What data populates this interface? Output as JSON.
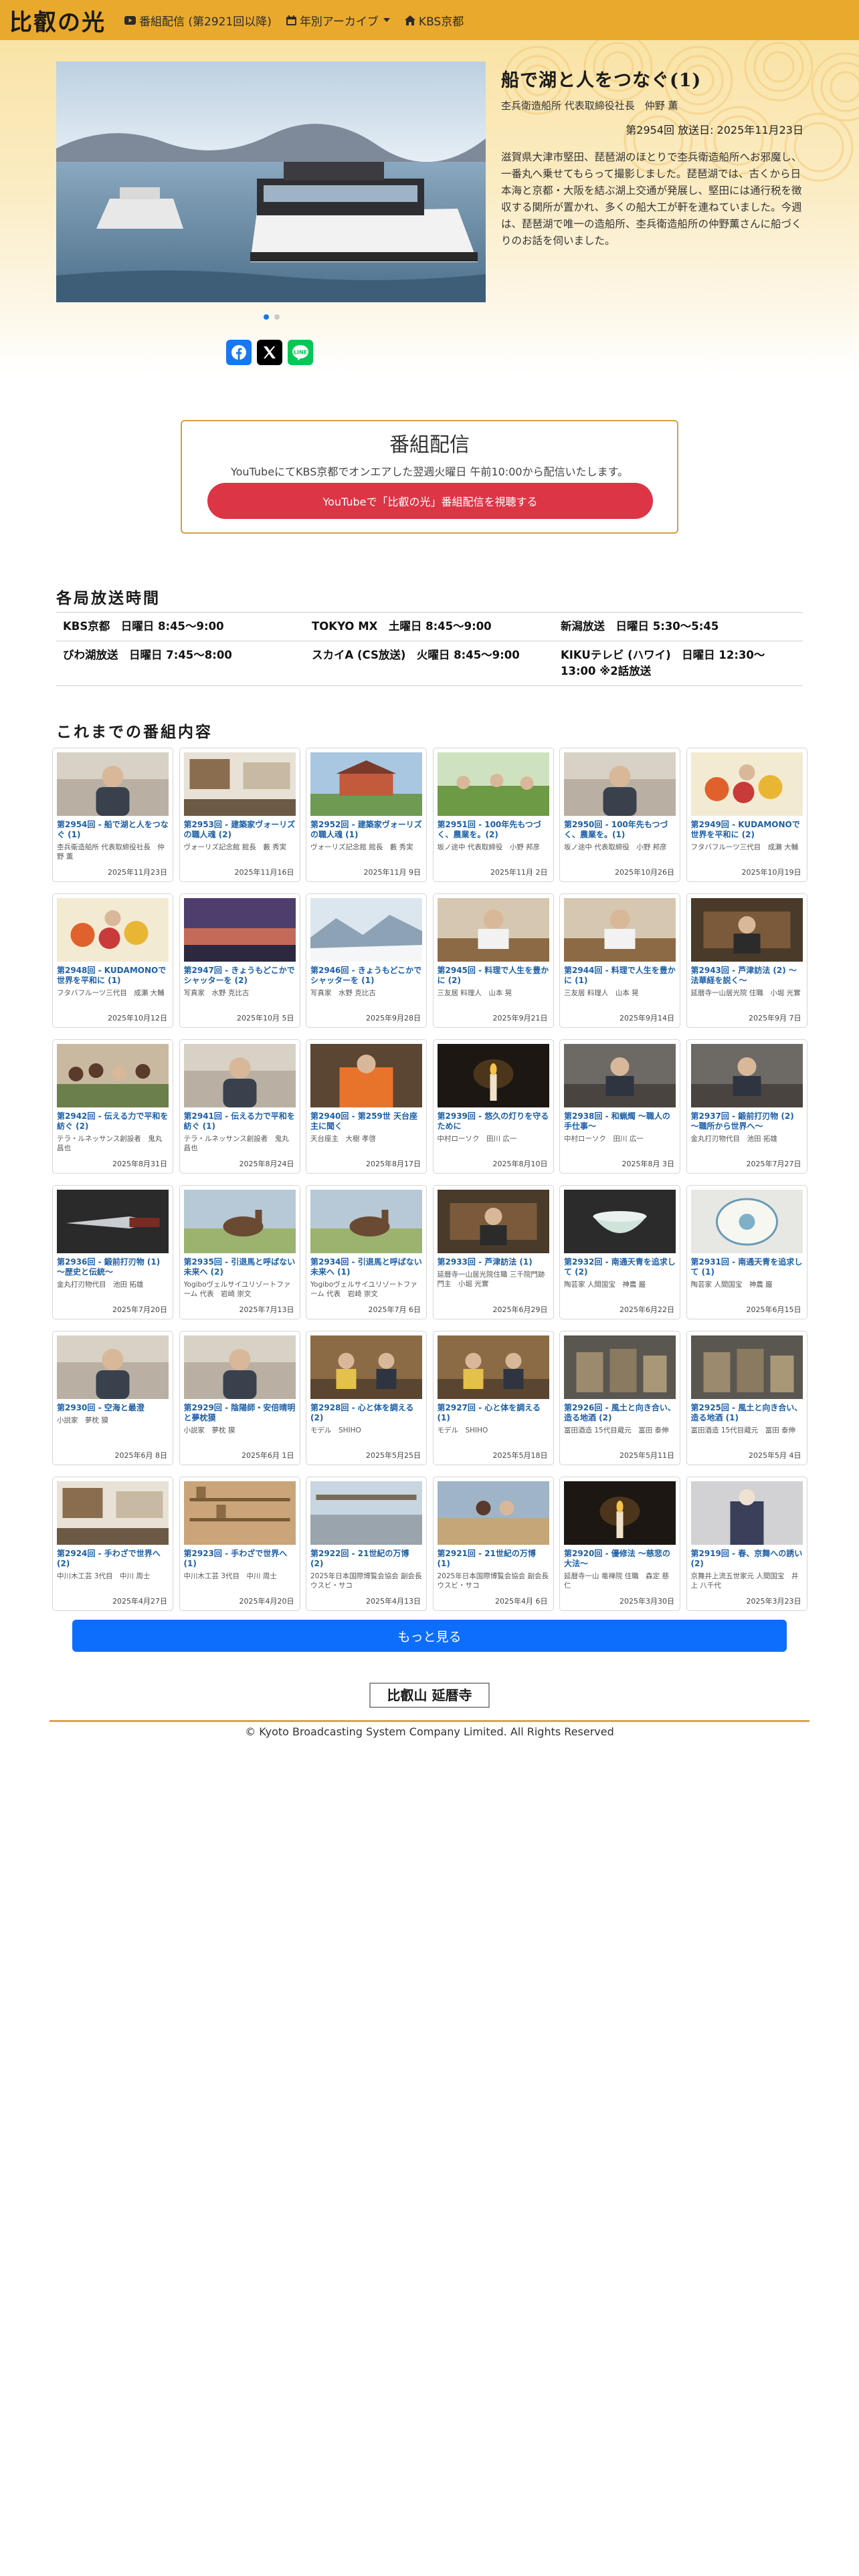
{
  "nav": {
    "brand": "比叡の光",
    "links": [
      {
        "label": "番組配信 (第2921回以降)",
        "icon": "youtube-icon"
      },
      {
        "label": "年別アーカイブ",
        "icon": "calendar-icon"
      },
      {
        "label": "KBS京都",
        "icon": "home-icon"
      }
    ],
    "color": "#e9a92c"
  },
  "hero": {
    "title": "船で湖と人をつなぐ(1)",
    "subtitle": "杢兵衛造船所 代表取締役社長　仲野 薫",
    "meta": "第2954回 放送日: 2025年11月23日",
    "description": "滋賀県大津市堅田、琵琶湖のほとりで杢兵衛造船所へお邪魔し、一番丸へ乗せてもらって撮影しました。琵琶湖では、古くから日本海と京都・大阪を結ぶ湖上交通が発展し、堅田には通行税を徴収する関所が置かれ、多くの船大工が軒を連ねていました。今週は、琵琶湖で唯一の造船所、杢兵衛造船所の仲野薫さんに船づくりのお話を伺いました。"
  },
  "broadcast": {
    "title": "番組配信",
    "text": "YouTubeにてKBS京都でオンエアした翌週火曜日 午前10:00から配信いたします。",
    "button": "YouTubeで「比叡の光」番組配信を視聴する"
  },
  "schedule": {
    "title": "各局放送時間",
    "rows": [
      [
        "KBS京都　日曜日 8:45～9:00",
        "TOKYO MX　土曜日 8:45～9:00",
        "新潟放送　日曜日 5:30～5:45"
      ],
      [
        "びわ湖放送　日曜日 7:45～8:00",
        "スカイA (CS放送)　火曜日 8:45～9:00",
        "KIKUテレビ (ハワイ)　日曜日 12:30～13:00 ※2話放送"
      ]
    ]
  },
  "episodes_title": "これまでの番組内容",
  "episodes": [
    {
      "title": "第2954回 - 船で湖と人をつなぐ (1)",
      "guest": "杢兵衛造船所 代表取締役社長　仲野 薫",
      "date": "2025年11月23日",
      "scene": "person"
    },
    {
      "title": "第2953回 - 建築家ヴォーリズの職人魂 (2)",
      "guest": "ヴォーリズ記念館 館長　藪 秀実",
      "date": "2025年11月16日",
      "scene": "room"
    },
    {
      "title": "第2952回 - 建築家ヴォーリズの職人魂 (1)",
      "guest": "ヴォーリズ記念館 館長　藪 秀実",
      "date": "2025年11月 9日",
      "scene": "building"
    },
    {
      "title": "第2951回 - 100年先もつづく、農業を。(2)",
      "guest": "坂ノ途中 代表取締役　小野 邦彦",
      "date": "2025年11月 2日",
      "scene": "field"
    },
    {
      "title": "第2950回 - 100年先もつづく、農業を。(1)",
      "guest": "坂ノ途中 代表取締役　小野 邦彦",
      "date": "2025年10月26日",
      "scene": "person"
    },
    {
      "title": "第2949回 - KUDAMONOで世界を平和に (2)",
      "guest": "フタバフルーツ三代目　成瀬 大輔",
      "date": "2025年10月19日",
      "scene": "fruit"
    },
    {
      "title": "第2948回 - KUDAMONOで世界を平和に (1)",
      "guest": "フタバフルーツ三代目　成瀬 大輔",
      "date": "2025年10月12日",
      "scene": "fruit"
    },
    {
      "title": "第2947回 - きょうもどこかでシャッターを (2)",
      "guest": "写真家　水野 克比古",
      "date": "2025年10月 5日",
      "scene": "sunset"
    },
    {
      "title": "第2946回 - きょうもどこかでシャッターを (1)",
      "guest": "写真家　水野 克比古",
      "date": "2025年9月28日",
      "scene": "snow"
    },
    {
      "title": "第2945回 - 料理で人生を豊かに (2)",
      "guest": "三友居 料理人　山本 晃",
      "date": "2025年9月21日",
      "scene": "kitchen"
    },
    {
      "title": "第2944回 - 料理で人生を豊かに (1)",
      "guest": "三友居 料理人　山本 晃",
      "date": "2025年9月14日",
      "scene": "kitchen"
    },
    {
      "title": "第2943回 - 芦津訪法 (2) ～法華経を説く～",
      "guest": "延暦寺一山居光院 住職　小堀 光實",
      "date": "2025年9月 7日",
      "scene": "temple"
    },
    {
      "title": "第2942回 - 伝える力で平和を紡ぐ (2)",
      "guest": "テラ・ルネッサンス創設者　鬼丸 昌也",
      "date": "2025年8月31日",
      "scene": "crowd"
    },
    {
      "title": "第2941回 - 伝える力で平和を紡ぐ (1)",
      "guest": "テラ・ルネッサンス創設者　鬼丸 昌也",
      "date": "2025年8月24日",
      "scene": "person"
    },
    {
      "title": "第2940回 - 第259世 天台座主に聞く",
      "guest": "天台座主　大樹 孝啓",
      "date": "2025年8月17日",
      "scene": "monk"
    },
    {
      "title": "第2939回 - 悠久の灯りを守るために",
      "guest": "中村ローソク　田川 広一",
      "date": "2025年8月10日",
      "scene": "candle"
    },
    {
      "title": "第2938回 - 和蝋燭 ～職人の手仕事～",
      "guest": "中村ローソク　田川 広一",
      "date": "2025年8月 3日",
      "scene": "workshop"
    },
    {
      "title": "第2937回 - 鍛前打刃物 (2) ～職所から世界へ～",
      "guest": "金丸打刃物代目　池田 拓雄",
      "date": "2025年7月27日",
      "scene": "workshop"
    },
    {
      "title": "第2936回 - 鍛前打刃物 (1) ～歴史と伝統～",
      "guest": "金丸打刃物代目　池田 拓雄",
      "date": "2025年7月20日",
      "scene": "knife"
    },
    {
      "title": "第2935回 - 引退馬と呼ばない未来へ (2)",
      "guest": "Yogiboヴェルサイユリゾートファーム 代表　岩崎 崇文",
      "date": "2025年7月13日",
      "scene": "horse"
    },
    {
      "title": "第2934回 - 引退馬と呼ばない未来へ (1)",
      "guest": "Yogiboヴェルサイユリゾートファーム 代表　岩崎 崇文",
      "date": "2025年7月 6日",
      "scene": "horse"
    },
    {
      "title": "第2933回 - 芦津訪法 (1)",
      "guest": "延暦寺一山居光院住職 三千院門跡門主　小堀 光實",
      "date": "2025年6月29日",
      "scene": "temple"
    },
    {
      "title": "第2932回 - 南通天青を追求して (2)",
      "guest": "陶芸家 人間国宝　神農 巌",
      "date": "2025年6月22日",
      "scene": "bowl"
    },
    {
      "title": "第2931回 - 南通天青を追求して (1)",
      "guest": "陶芸家 人間国宝　神農 巌",
      "date": "2025年6月15日",
      "scene": "plate"
    },
    {
      "title": "第2930回 - 空海と最澄",
      "guest": "小説家　夢枕 獏",
      "date": "2025年6月 8日",
      "scene": "person"
    },
    {
      "title": "第2929回 - 陰陽師・安倍晴明と夢枕獏",
      "guest": "小説家　夢枕 獏",
      "date": "2025年6月 1日",
      "scene": "person"
    },
    {
      "title": "第2928回 - 心と体を調える (2)",
      "guest": "モデル　SHIHO",
      "date": "2025年5月25日",
      "scene": "talk"
    },
    {
      "title": "第2927回 - 心と体を調える (1)",
      "guest": "モデル　SHIHO",
      "date": "2025年5月18日",
      "scene": "talk"
    },
    {
      "title": "第2926回 - 風土と向き合い、造る地酒 (2)",
      "guest": "冨田酒造 15代目蔵元　冨田 泰伸",
      "date": "2025年5月11日",
      "scene": "brewery"
    },
    {
      "title": "第2925回 - 風土と向き合い、造る地酒 (1)",
      "guest": "冨田酒造 15代目蔵元　冨田 泰伸",
      "date": "2025年5月 4日",
      "scene": "brewery"
    },
    {
      "title": "第2924回 - 手わざで世界へ (2)",
      "guest": "中川木工芸 3代目　中川 周士",
      "date": "2025年4月27日",
      "scene": "room"
    },
    {
      "title": "第2923回 - 手わざで世界へ (1)",
      "guest": "中川木工芸 3代目　中川 周士",
      "date": "2025年4月20日",
      "scene": "shelf"
    },
    {
      "title": "第2922回 - 21世紀の万博 (2)",
      "guest": "2025年日本国際博覧会協会 副会長　ウスビ・サコ",
      "date": "2025年4月13日",
      "scene": "expo"
    },
    {
      "title": "第2921回 - 21世紀の万博 (1)",
      "guest": "2025年日本国際博覧会協会 副会長　ウスビ・サコ",
      "date": "2025年4月 6日",
      "scene": "expo2"
    },
    {
      "title": "第2920回 - 優修法 ～慈悲の大法～",
      "guest": "延暦寺一山 竜禅院 住職　森定 慈仁",
      "date": "2025年3月30日",
      "scene": "candle"
    },
    {
      "title": "第2919回 - 春、京舞への誘い (2)",
      "guest": "京舞井上流五世家元 人間国宝　井上 八千代",
      "date": "2025年3月23日",
      "scene": "dance"
    }
  ],
  "more_button": "もっと見る",
  "footer": {
    "logo_text": "比叡山 延暦寺",
    "copyright": "© Kyoto Broadcasting System Company Limited. All Rights Reserved"
  }
}
